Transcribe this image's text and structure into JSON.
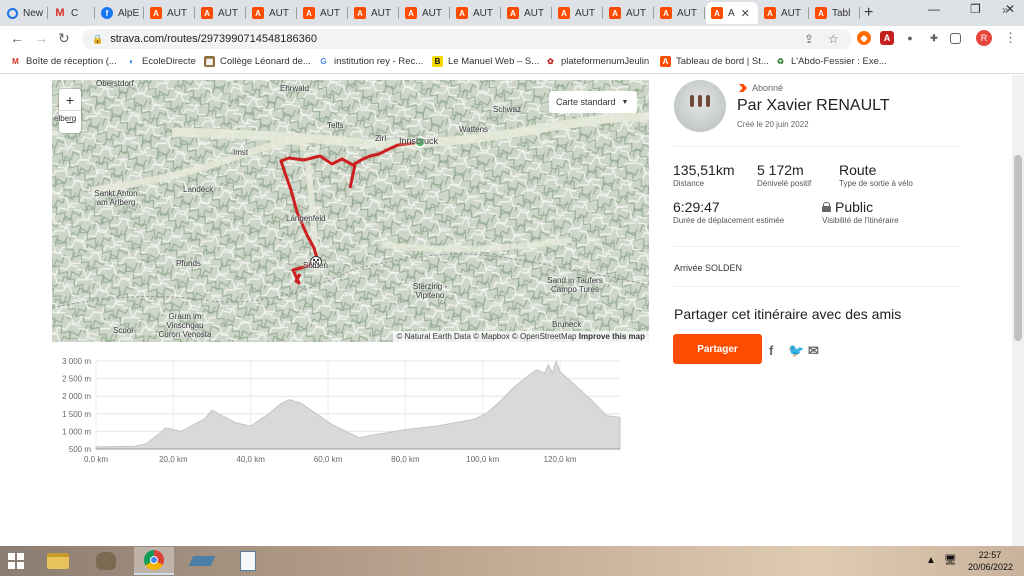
{
  "browser": {
    "tabs": [
      {
        "label": "New",
        "icon": "edge-icon",
        "active": false
      },
      {
        "label": "C",
        "icon": "gmail-icon",
        "active": false
      },
      {
        "label": "AlpE",
        "icon": "facebook-icon",
        "active": false
      },
      {
        "label": "AUT",
        "icon": "strava-icon",
        "active": false
      },
      {
        "label": "AUT",
        "icon": "strava-icon",
        "active": false
      },
      {
        "label": "AUT",
        "icon": "strava-icon",
        "active": false
      },
      {
        "label": "AUT",
        "icon": "strava-icon",
        "active": false
      },
      {
        "label": "AUT",
        "icon": "strava-icon",
        "active": false
      },
      {
        "label": "AUT",
        "icon": "strava-icon",
        "active": false
      },
      {
        "label": "AUT",
        "icon": "strava-icon",
        "active": false
      },
      {
        "label": "AUT",
        "icon": "strava-icon",
        "active": false
      },
      {
        "label": "AUT",
        "icon": "strava-icon",
        "active": false
      },
      {
        "label": "AUT",
        "icon": "strava-icon",
        "active": false
      },
      {
        "label": "AUT",
        "icon": "strava-icon",
        "active": false
      },
      {
        "label": "A",
        "icon": "strava-icon",
        "active": true
      },
      {
        "label": "AUT",
        "icon": "strava-icon",
        "active": false
      },
      {
        "label": "Tabl",
        "icon": "strava-icon",
        "active": false
      }
    ],
    "new_tab": "+",
    "url": "strava.com/routes/2973990714548186360",
    "profile_initial": "R"
  },
  "bookmarks": [
    {
      "label": "Boîte de réception (...",
      "icon": "gmail-icon"
    },
    {
      "label": "EcoleDirecte",
      "icon": "ecoledirecte-icon"
    },
    {
      "label": "Collège Léonard de...",
      "icon": "school-icon"
    },
    {
      "label": "institution rey - Rec...",
      "icon": "google-icon"
    },
    {
      "label": "Le Manuel Web – S...",
      "icon": "b-icon"
    },
    {
      "label": "plateformenumJeulin",
      "icon": "jeulin-icon"
    },
    {
      "label": "Tableau de bord | St...",
      "icon": "strava-icon"
    },
    {
      "label": "L'Abdo-Fessier : Exe...",
      "icon": "recycle-icon"
    }
  ],
  "map": {
    "style_selector": "Carte standard",
    "zoom_in": "+",
    "zoom_out": "−",
    "attribution_prefix": "© Natural Earth Data © Mapbox © OpenStreetMap",
    "attribution_link": "Improve this map",
    "places": [
      "Oberstdorf",
      "Ehrwald",
      "Schwaz",
      "elberg",
      "Telfs",
      "Zirl",
      "Innsbruck",
      "Wattens",
      "Imst",
      "Landeck",
      "Sankt Anton am Arlberg",
      "Längenfeld",
      "Sölden",
      "Pfunds",
      "Sterzing - Vipiteno",
      "Sand in Taufers Campo Tures",
      "Graun im Vinschgau Curon Venosta",
      "Scuol",
      "Bruneck"
    ],
    "route_color": "#cc1f1f",
    "start_color": "#2ea84a"
  },
  "chart_data": {
    "type": "area",
    "title": "",
    "xlabel": "",
    "ylabel": "",
    "x_ticks": [
      "0,0 km",
      "20,0 km",
      "40,0 km",
      "60,0 km",
      "80,0 km",
      "100,0 km",
      "120,0 km"
    ],
    "y_ticks": [
      "500 m",
      "1 000 m",
      "1 500 m",
      "2 000 m",
      "2 500 m",
      "3 000 m"
    ],
    "xlim": [
      0,
      135.5
    ],
    "ylim": [
      500,
      3000
    ],
    "x": [
      0,
      10,
      13,
      16,
      18,
      22,
      28,
      30,
      36,
      40,
      44,
      48,
      50,
      53,
      57,
      61,
      65,
      68,
      72,
      80,
      88,
      98,
      101,
      104,
      108,
      112,
      114,
      116,
      117,
      118,
      119,
      120,
      122,
      124,
      128,
      132,
      135.5
    ],
    "series": [
      {
        "values": [
          560,
          580,
          650,
          900,
          1100,
          1000,
          1350,
          1600,
          1250,
          1150,
          1450,
          1800,
          1900,
          1800,
          1500,
          1200,
          980,
          820,
          900,
          1050,
          1150,
          1350,
          1520,
          1800,
          2250,
          2600,
          2750,
          2650,
          2900,
          2650,
          3000,
          2700,
          2500,
          2300,
          1900,
          1450,
          1400
        ]
      }
    ],
    "fill": "#d9d9d9",
    "grid": true
  },
  "route": {
    "subscription": "Abonné",
    "author": "Par Xavier RENAULT",
    "created": "Créé le 20 juin 2022",
    "distance_value": "135,51km",
    "distance_label": "Distance",
    "elevation_value": "5 172m",
    "elevation_label": "Dénivelé positif",
    "type_value": "Route",
    "type_label": "Type de sortie à vélo",
    "duration_value": "6:29:47",
    "duration_label": "Durée de déplacement estimée",
    "visibility_value": "Public",
    "visibility_label": "Visibilité de l'itinéraire",
    "arrival": "Arrivée SOLDEN",
    "share_title": "Partager cet itinéraire avec des amis",
    "share_button": "Partager",
    "accent": "#fc4c02"
  },
  "taskbar": {
    "time": "22:57",
    "date": "20/06/2022"
  }
}
